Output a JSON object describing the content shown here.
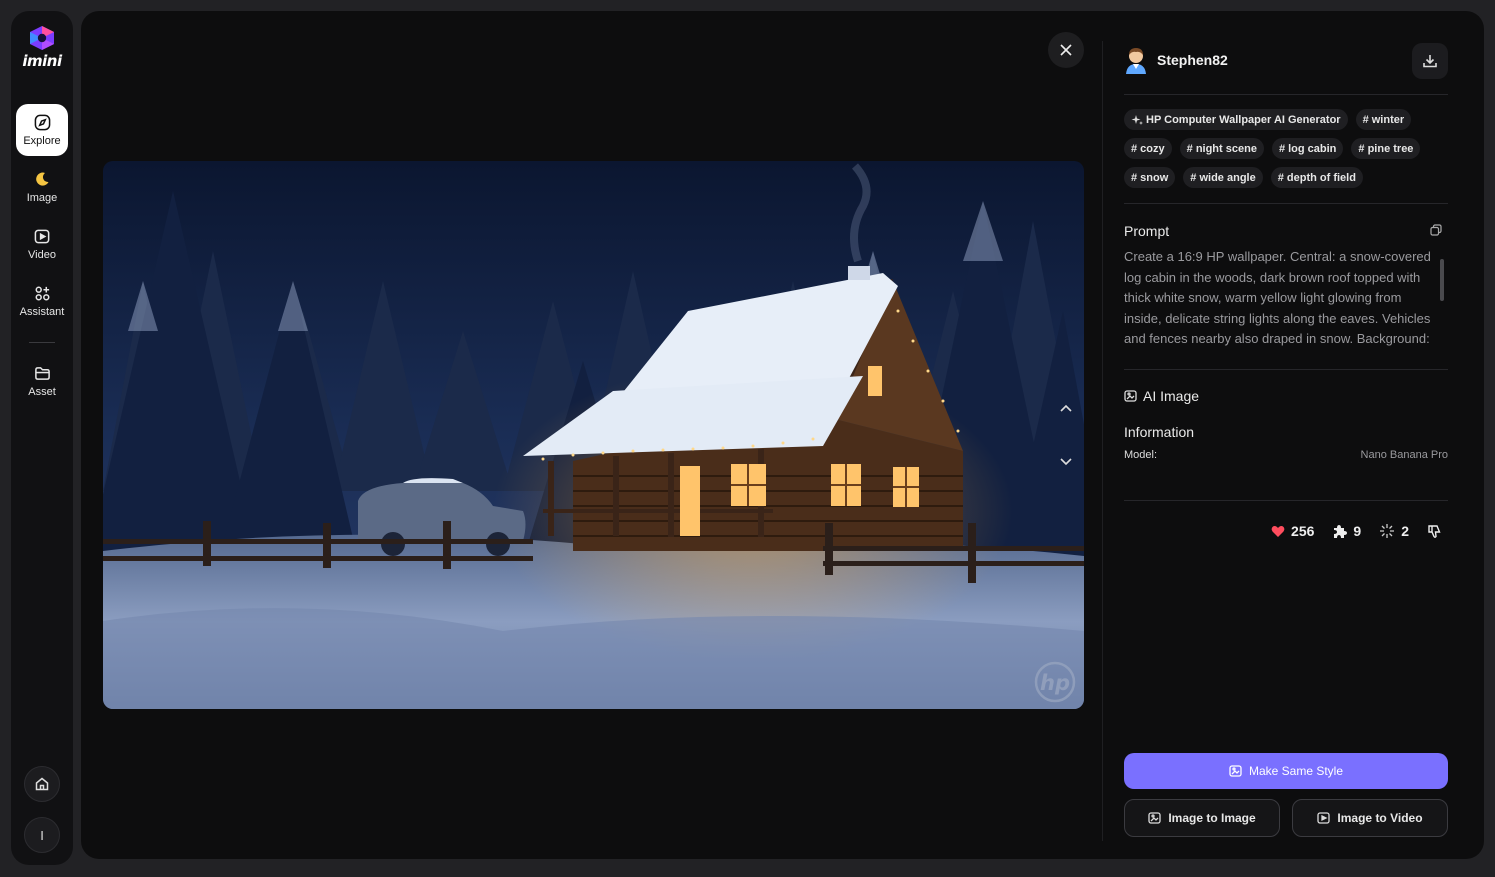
{
  "brand": {
    "name": "imini"
  },
  "nav": [
    {
      "label": "Explore",
      "icon": "compass-icon",
      "active": true
    },
    {
      "label": "Image",
      "icon": "moon-icon"
    },
    {
      "label": "Video",
      "icon": "video-play-icon"
    },
    {
      "label": "Assistant",
      "icon": "apps-icon"
    },
    {
      "label": "Asset",
      "icon": "folder-icon"
    }
  ],
  "sidebar_bottom": {
    "home_icon": "home-icon",
    "user_initial": "I"
  },
  "viewer": {
    "image_icon": "snowy-log-cabin-night-image",
    "watermark": "hp"
  },
  "author": {
    "name": "Stephen82",
    "avatar": "avatar-icon"
  },
  "tags": [
    "HP Computer Wallpaper AI Generator",
    "# winter",
    "# cozy",
    "# night scene",
    "# log cabin",
    "# pine tree",
    "# snow",
    "# wide angle",
    "# depth of field"
  ],
  "prompt": {
    "title": "Prompt",
    "text": "Create a 16:9 HP wallpaper. Central: a snow-covered log cabin in the woods, dark brown roof topped with thick white snow, warm yellow light glowing from inside, delicate string lights along the eaves. Vehicles and fences nearby also draped in snow. Background: dark"
  },
  "type_label": "AI Image",
  "information": {
    "title": "Information",
    "model_label": "Model:",
    "model_value": "Nano Banana Pro"
  },
  "stats": {
    "likes": "256",
    "remixes": "9",
    "uses": "2"
  },
  "buttons": {
    "make_same": "Make Same Style",
    "img2img": "Image to Image",
    "img2vid": "Image to Video"
  },
  "colors": {
    "accent": "#7a70ff",
    "heart": "#ff4d5e",
    "panel": "#0d0d0e",
    "page": "#222225"
  }
}
